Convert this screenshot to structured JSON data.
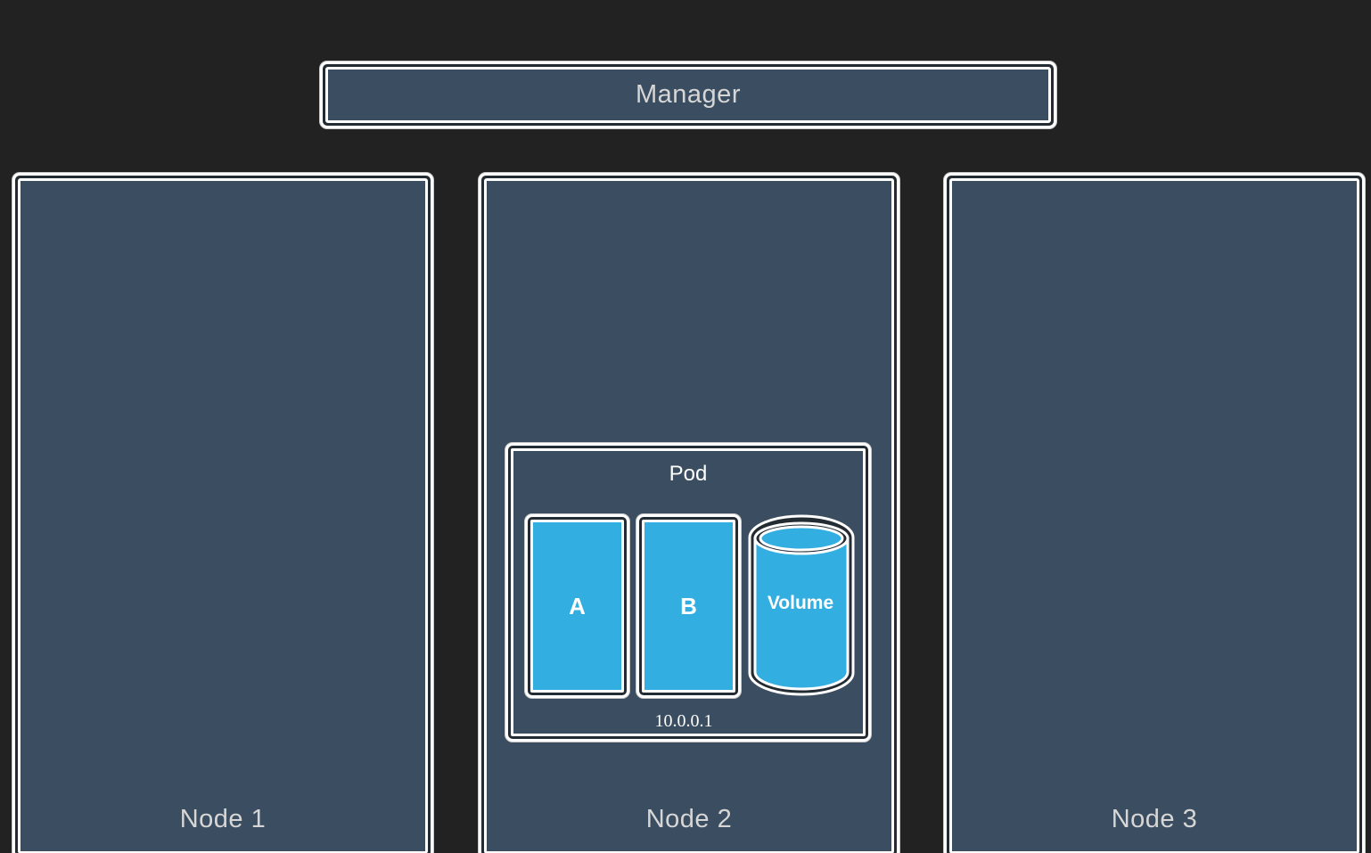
{
  "manager": {
    "label": "Manager"
  },
  "nodes": [
    {
      "label": "Node 1"
    },
    {
      "label": "Node 2"
    },
    {
      "label": "Node 3"
    }
  ],
  "pod": {
    "label": "Pod",
    "ip": "10.0.0.1",
    "containers": [
      {
        "label": "A"
      },
      {
        "label": "B"
      }
    ],
    "volume": {
      "label": "Volume"
    }
  },
  "colors": {
    "background": "#222222",
    "box_fill": "#3b4d60",
    "container_fill": "#33aee0",
    "outline": "#ffffff",
    "text_light": "#d6d6d6"
  }
}
